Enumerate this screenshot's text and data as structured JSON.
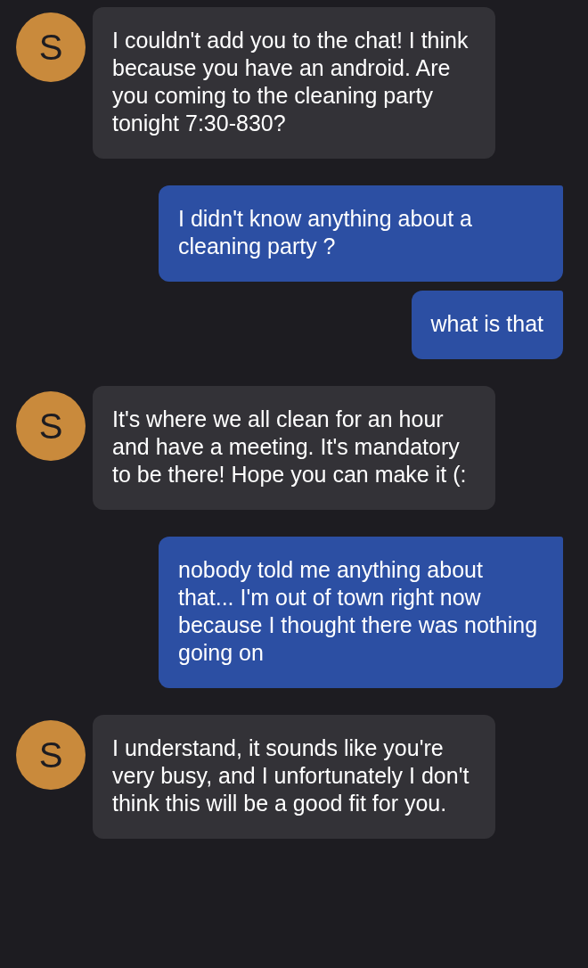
{
  "messages": [
    {
      "kind": "incoming",
      "avatar": "S",
      "text": "I couldn't add you to the chat! I think because you have an android. Are you coming to the cleaning party tonight 7:30-830?"
    },
    {
      "kind": "outgoing",
      "text": "I didn't know anything about a cleaning party ?"
    },
    {
      "kind": "outgoing",
      "text": "what is that"
    },
    {
      "kind": "incoming",
      "avatar": "S",
      "text": "It's where we all clean for an hour and have a meeting. It's mandatory to be there! Hope you can make it (:"
    },
    {
      "kind": "outgoing",
      "text": "nobody told me anything about that... I'm out of town right now because I thought there was nothing going on"
    },
    {
      "kind": "incoming",
      "avatar": "S",
      "text": "I understand, it sounds like you're very busy, and I unfortunately I don't think this will be a good fit for you."
    }
  ]
}
